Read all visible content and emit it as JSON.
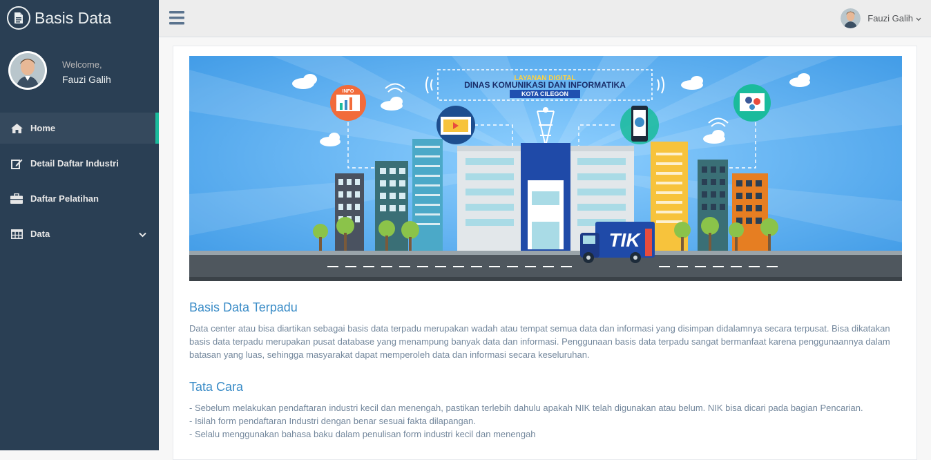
{
  "app": {
    "brand": "Basis Data",
    "brand_icon": "file-text-icon"
  },
  "profile": {
    "welcome": "Welcome,",
    "name": "Fauzi Galih"
  },
  "sidebar": {
    "items": [
      {
        "label": "Home",
        "icon": "home-icon",
        "active": true
      },
      {
        "label": "Detail Daftar Industri",
        "icon": "edit-icon",
        "active": false
      },
      {
        "label": "Daftar Pelatihan",
        "icon": "briefcase-icon",
        "active": false
      },
      {
        "label": "Data",
        "icon": "table-icon",
        "active": false,
        "has_submenu": true
      }
    ]
  },
  "topbar": {
    "user_name": "Fauzi Galih"
  },
  "banner": {
    "line1": "LAYANAN DIGITAL",
    "line2": "DINAS KOMUNIKASI DAN INFORMATIKA",
    "line3": "KOTA CILEGON",
    "truck_label": "TIK",
    "chart_sign": "INFO"
  },
  "content": {
    "section1_title": "Basis Data Terpadu",
    "section1_text": "Data center atau bisa diartikan sebagai basis data terpadu merupakan wadah atau tempat semua data dan informasi yang disimpan didalamnya secara terpusat. Bisa dikatakan basis data terpadu merupakan pusat database yang menampung banyak data dan informasi. Penggunaan basis data terpadu sangat bermanfaat karena penggunaannya dalam batasan yang luas, sehingga masyarakat dapat memperoleh data dan informasi secara keseluruhan.",
    "section2_title": "Tata Cara",
    "section2_items": [
      "- Sebelum melakukan pendaftaran industri kecil dan menengah, pastikan terlebih dahulu apakah NIK telah digunakan atau belum. NIK bisa dicari pada bagian Pencarian.",
      "- Isilah form pendaftaran Industri dengan benar sesuai fakta dilapangan.",
      "- Selalu menggunakan bahasa baku dalam penulisan form industri kecil dan menengah"
    ]
  },
  "colors": {
    "sidebar_bg": "#2a3f54",
    "accent": "#1abb9c",
    "heading": "#3a8cc7",
    "banner_sky": "#4aa3ea"
  }
}
